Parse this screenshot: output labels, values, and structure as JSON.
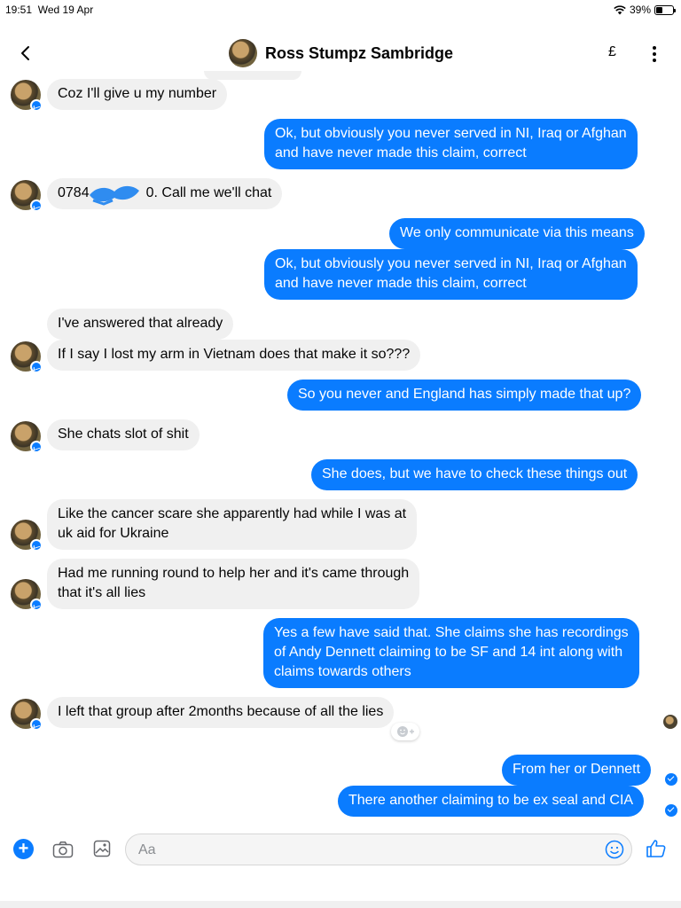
{
  "status_bar": {
    "time": "19:51",
    "date": "Wed 19 Apr",
    "battery": "39%",
    "battery_level": 0.39
  },
  "header": {
    "contact_name": "Ross Stumpz Sambridge",
    "pound_label": "£"
  },
  "messages": [
    {
      "dir": "in",
      "lines": [
        "Coz I'll give u my number"
      ]
    },
    {
      "dir": "out",
      "lines": [
        "Ok, but obviously you never served in NI, Iraq or Afghan",
        "and have never made this claim, correct"
      ]
    },
    {
      "dir": "in",
      "lines": [
        "0784",
        "0. Call me we'll chat"
      ]
    },
    {
      "dir": "out",
      "lines": [
        "We only communicate via this means"
      ]
    },
    {
      "dir": "out",
      "lines": [
        "Ok, but obviously you never served in NI, Iraq or Afghan",
        "and have never made this claim, correct"
      ]
    },
    {
      "dir": "in",
      "lines": [
        "I've answered that already"
      ]
    },
    {
      "dir": "in",
      "lines": [
        "If I say I lost my arm in Vietnam does that make it so???"
      ]
    },
    {
      "dir": "out",
      "lines": [
        "So you never and England has simply made that up?"
      ]
    },
    {
      "dir": "in",
      "lines": [
        "She chats slot of shit"
      ]
    },
    {
      "dir": "out",
      "lines": [
        "She does, but we have to check these things out"
      ]
    },
    {
      "dir": "in",
      "lines": [
        "Like the cancer scare she apparently had while I was at",
        "uk aid for Ukraine"
      ]
    },
    {
      "dir": "in",
      "lines": [
        "Had me running round to help her and it's came through",
        "that it's all lies"
      ]
    },
    {
      "dir": "out",
      "lines": [
        "Yes a few have said that. She claims she has recordings",
        "of Andy Dennett claiming to be SF and 14 int along with",
        "claims towards others"
      ]
    },
    {
      "dir": "in",
      "lines": [
        "I left that group after 2months because of all the lies"
      ]
    },
    {
      "dir": "out",
      "lines": [
        "From her or Dennett"
      ]
    },
    {
      "dir": "out",
      "lines": [
        "There another claiming to be ex seal and CIA"
      ]
    }
  ],
  "composer": {
    "placeholder": "Aa"
  },
  "colors": {
    "accent": "#0a7cff",
    "incoming_bg": "#f0f0f0",
    "redaction": "#2f8cf0"
  },
  "icons": [
    "back-chevron-icon",
    "more-vertical-icon",
    "plus-icon",
    "camera-icon",
    "image-icon",
    "emoji-icon",
    "like-thumb-icon",
    "messenger-badge-icon",
    "add-reaction-icon",
    "seen-check-icon"
  ]
}
